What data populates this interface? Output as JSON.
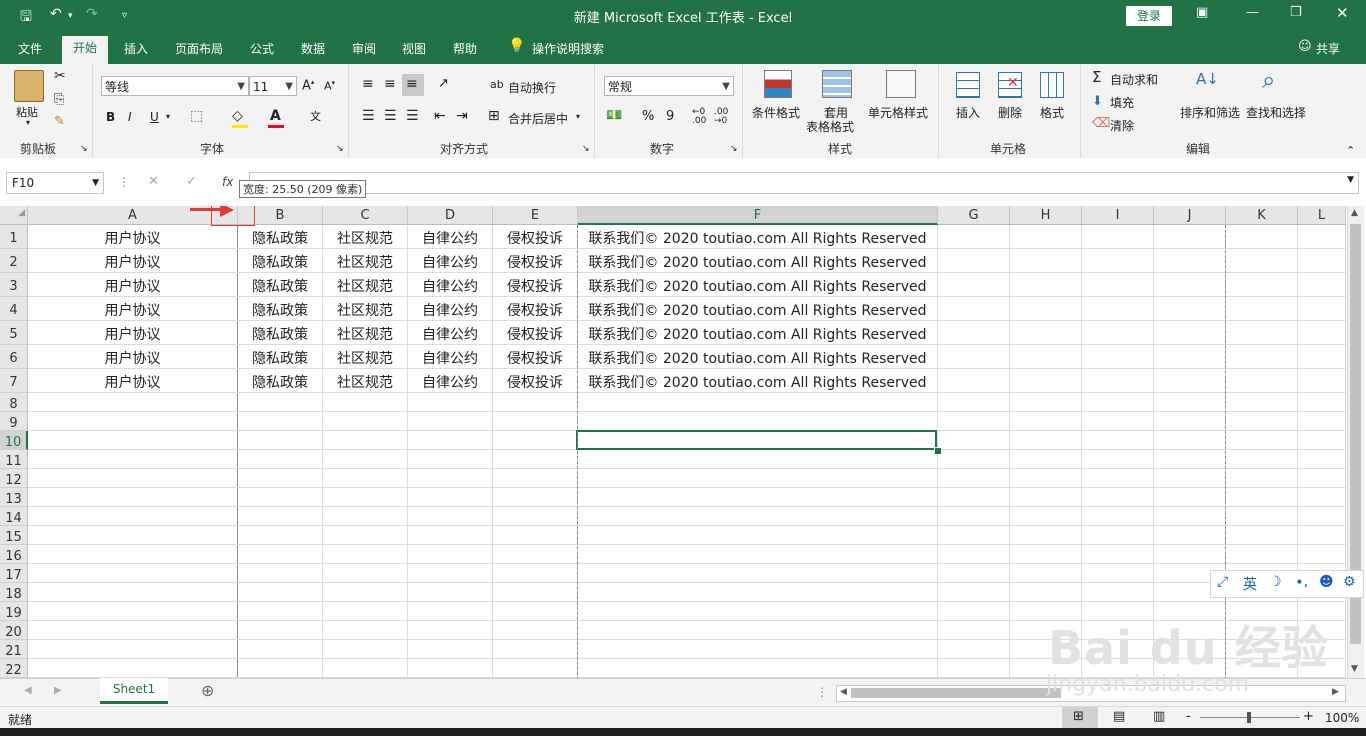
{
  "window": {
    "title": "新建 Microsoft Excel 工作表  -  Excel",
    "login_label": "登录"
  },
  "menu": {
    "tabs": [
      "文件",
      "开始",
      "插入",
      "页面布局",
      "公式",
      "数据",
      "审阅",
      "视图",
      "帮助"
    ],
    "search_label": "操作说明搜索",
    "share_label": "共享"
  },
  "ribbon": {
    "clipboard": {
      "paste": "粘贴",
      "label": "剪贴板"
    },
    "font": {
      "name": "等线",
      "size": "11",
      "label": "字体",
      "bold": "B",
      "italic": "I",
      "underline": "U"
    },
    "alignment": {
      "wrap": "自动换行",
      "merge": "合并后居中",
      "label": "对齐方式"
    },
    "number": {
      "format": "常规",
      "percent": "%",
      "comma": "9",
      "label": "数字"
    },
    "styles": {
      "conditional": "条件格式",
      "table_line1": "套用",
      "table_line2": "表格格式",
      "cell_styles": "单元格样式",
      "label": "样式"
    },
    "cells": {
      "insert": "插入",
      "delete": "删除",
      "format": "格式",
      "label": "单元格"
    },
    "editing": {
      "autosum": "自动求和",
      "fill": "填充",
      "clear": "清除",
      "sort": "排序和筛选",
      "find": "查找和选择",
      "label": "编辑"
    }
  },
  "formula_bar": {
    "name_box": "F10",
    "fx": "fx",
    "tooltip": "宽度: 25.50 (209 像素)"
  },
  "sheet": {
    "columns": [
      "A",
      "B",
      "C",
      "D",
      "E",
      "F",
      "G",
      "H",
      "I",
      "J",
      "K",
      "L"
    ],
    "rows": [
      "1",
      "2",
      "3",
      "4",
      "5",
      "6",
      "7",
      "8",
      "9",
      "10",
      "11",
      "12",
      "13",
      "14",
      "15",
      "16",
      "17",
      "18",
      "19",
      "20",
      "21",
      "22"
    ],
    "data": [
      [
        "用户协议",
        "隐私政策",
        "社区规范",
        "自律公约",
        "侵权投诉",
        "联系我们© 2020 toutiao.com All Rights Reserved"
      ],
      [
        "用户协议",
        "隐私政策",
        "社区规范",
        "自律公约",
        "侵权投诉",
        "联系我们© 2020 toutiao.com All Rights Reserved"
      ],
      [
        "用户协议",
        "隐私政策",
        "社区规范",
        "自律公约",
        "侵权投诉",
        "联系我们© 2020 toutiao.com All Rights Reserved"
      ],
      [
        "用户协议",
        "隐私政策",
        "社区规范",
        "自律公约",
        "侵权投诉",
        "联系我们© 2020 toutiao.com All Rights Reserved"
      ],
      [
        "用户协议",
        "隐私政策",
        "社区规范",
        "自律公约",
        "侵权投诉",
        "联系我们© 2020 toutiao.com All Rights Reserved"
      ],
      [
        "用户协议",
        "隐私政策",
        "社区规范",
        "自律公约",
        "侵权投诉",
        "联系我们© 2020 toutiao.com All Rights Reserved"
      ],
      [
        "用户协议",
        "隐私政策",
        "社区规范",
        "自律公约",
        "侵权投诉",
        "联系我们© 2020 toutiao.com All Rights Reserved"
      ]
    ],
    "selected_cell": "F10",
    "sheet_tab": "Sheet1"
  },
  "status": {
    "ready": "就绪",
    "zoom": "100%",
    "minus": "-",
    "plus": "+"
  },
  "ime": {
    "lang": "英"
  },
  "watermark": {
    "line1": "Bai du 经验",
    "line2": "jingyan.baidu.com"
  },
  "colors": {
    "accent": "#217346",
    "annotation": "#e53935",
    "selection": "#217346"
  }
}
